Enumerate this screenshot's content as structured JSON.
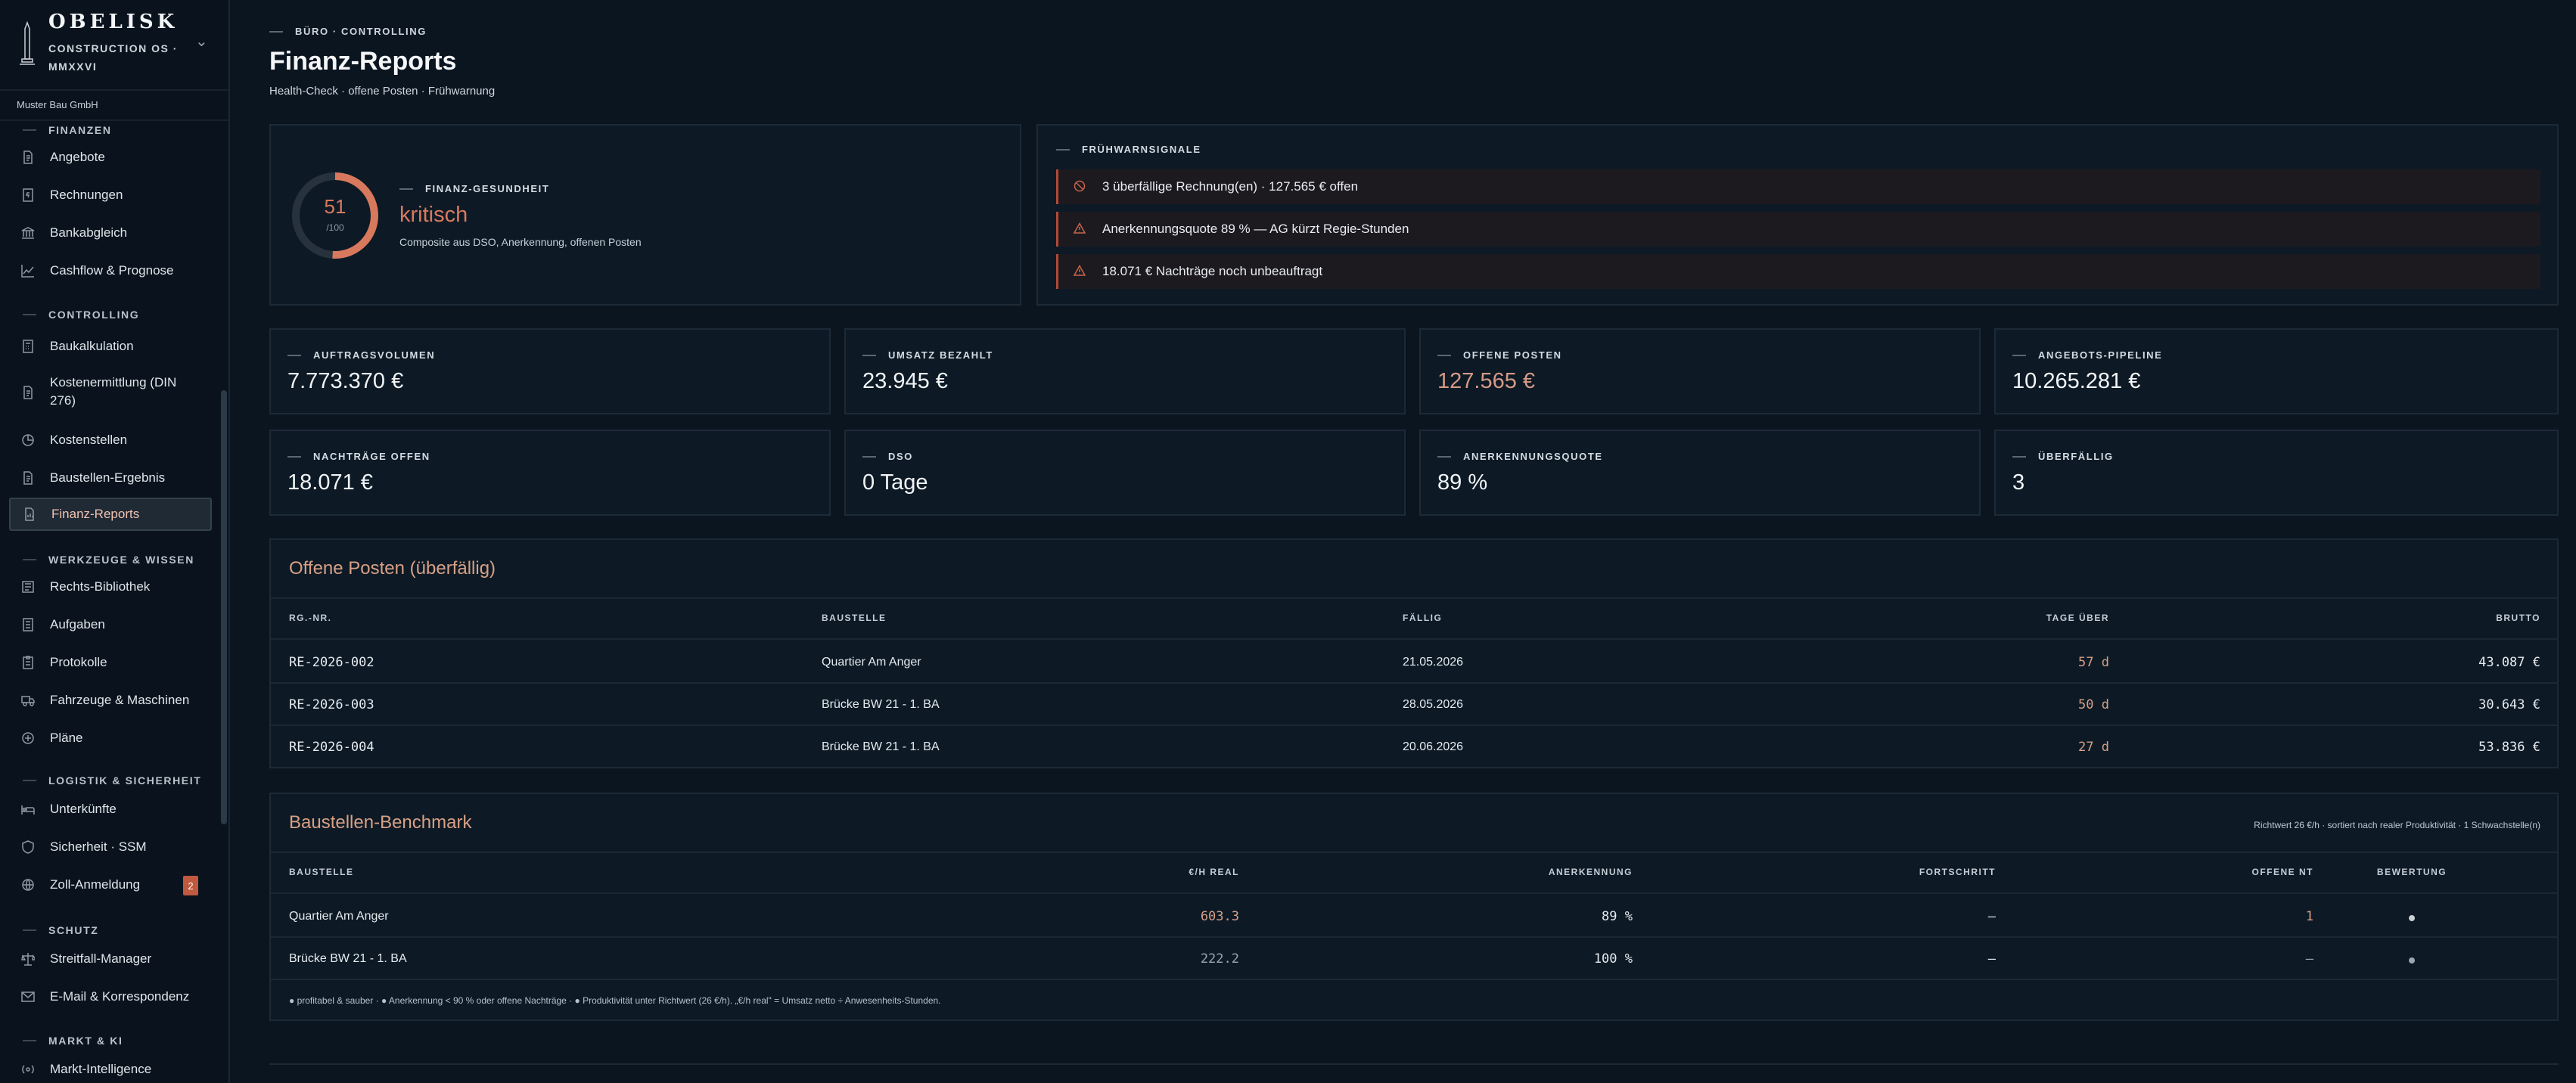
{
  "brand": {
    "name": "OBELISK",
    "subtitle": "CONSTRUCTION OS · MMXXVI",
    "company": "Muster Bau GmbH"
  },
  "sidebar": {
    "sections": [
      {
        "title": "FINANZEN",
        "items": [
          {
            "label": "Angebote",
            "icon": "document-icon"
          },
          {
            "label": "Rechnungen",
            "icon": "invoice-icon"
          },
          {
            "label": "Bankabgleich",
            "icon": "bank-icon"
          },
          {
            "label": "Cashflow & Prognose",
            "icon": "chart-line-icon"
          }
        ]
      },
      {
        "title": "CONTROLLING",
        "items": [
          {
            "label": "Baukalkulation",
            "icon": "calculator-icon"
          },
          {
            "label": "Kostenermittlung (DIN 276)",
            "icon": "document-icon"
          },
          {
            "label": "Kostenstellen",
            "icon": "pie-icon"
          },
          {
            "label": "Baustellen-Ergebnis",
            "icon": "document-icon"
          },
          {
            "label": "Finanz-Reports",
            "icon": "report-icon",
            "active": true
          }
        ]
      },
      {
        "title": "WERKZEUGE & WISSEN",
        "items": [
          {
            "label": "Rechts-Bibliothek",
            "icon": "library-icon"
          },
          {
            "label": "Aufgaben",
            "icon": "checklist-icon"
          },
          {
            "label": "Protokolle",
            "icon": "clipboard-icon"
          },
          {
            "label": "Fahrzeuge & Maschinen",
            "icon": "truck-icon"
          },
          {
            "label": "Pläne",
            "icon": "blueprint-icon"
          }
        ]
      },
      {
        "title": "LOGISTIK & SICHERHEIT",
        "items": [
          {
            "label": "Unterkünfte",
            "icon": "bed-icon"
          },
          {
            "label": "Sicherheit · SSM",
            "icon": "shield-icon"
          },
          {
            "label": "Zoll-Anmeldung",
            "icon": "globe-icon",
            "badge": "2"
          }
        ]
      },
      {
        "title": "SCHUTZ",
        "items": [
          {
            "label": "Streitfall-Manager",
            "icon": "scales-icon"
          },
          {
            "label": "E-Mail & Korrespondenz",
            "icon": "mail-icon"
          }
        ]
      },
      {
        "title": "MARKT & KI",
        "items": [
          {
            "label": "Markt-Intelligence",
            "icon": "radar-icon"
          }
        ]
      }
    ]
  },
  "page": {
    "breadcrumb": "BÜRO · CONTROLLING",
    "title": "Finanz-Reports",
    "subtitle": "Health-Check · offene Posten · Frühwarnung"
  },
  "health": {
    "label": "FINANZ-GESUNDHEIT",
    "score": "51",
    "score_value": 51,
    "max": "/100",
    "status": "kritisch",
    "description": "Composite aus DSO, Anerkennung, offenen Posten",
    "color": "#d8795d"
  },
  "warnings": {
    "label": "FRÜHWARNSIGNALE",
    "items": [
      {
        "icon": "clock-alert-icon",
        "text": "3 überfällige Rechnung(en) · 127.565 € offen"
      },
      {
        "icon": "warning-triangle-icon",
        "text": "Anerkennungsquote 89 % — AG kürzt Regie-Stunden"
      },
      {
        "icon": "warning-triangle-icon",
        "text": "18.071 € Nachträge noch unbeauftragt"
      }
    ]
  },
  "kpis": [
    {
      "label": "AUFTRAGSVOLUMEN",
      "value": "7.773.370 €"
    },
    {
      "label": "UMSATZ BEZAHLT",
      "value": "23.945 €"
    },
    {
      "label": "OFFENE POSTEN",
      "value": "127.565 €",
      "warm": true
    },
    {
      "label": "ANGEBOTS-PIPELINE",
      "value": "10.265.281 €"
    },
    {
      "label": "NACHTRÄGE OFFEN",
      "value": "18.071 €"
    },
    {
      "label": "DSO",
      "value": "0 Tage"
    },
    {
      "label": "ANERKENNUNGSQUOTE",
      "value": "89 %"
    },
    {
      "label": "ÜBERFÄLLIG",
      "value": "3"
    }
  ],
  "open_items": {
    "title": "Offene Posten (überfällig)",
    "columns": [
      "RG.-NR.",
      "BAUSTELLE",
      "FÄLLIG",
      "TAGE ÜBER",
      "BRUTTO"
    ],
    "rows": [
      [
        "RE-2026-002",
        "Quartier Am Anger",
        "21.05.2026",
        "57 d",
        "43.087 €"
      ],
      [
        "RE-2026-003",
        "Brücke BW 21 - 1. BA",
        "28.05.2026",
        "50 d",
        "30.643 €"
      ],
      [
        "RE-2026-004",
        "Brücke BW 21 - 1. BA",
        "20.06.2026",
        "27 d",
        "53.836 €"
      ]
    ]
  },
  "benchmark": {
    "title": "Baustellen-Benchmark",
    "note": "Richtwert 26 €/h · sortiert nach realer Produktivität · 1 Schwachstelle(n)",
    "columns": [
      "BAUSTELLE",
      "€/H REAL",
      "ANERKENNUNG",
      "FORTSCHRITT",
      "OFFENE NT",
      "BEWERTUNG"
    ],
    "rows": [
      [
        "Quartier Am Anger",
        "603.3",
        "89 %",
        "—",
        "1",
        "●"
      ],
      [
        "Brücke BW 21 - 1. BA",
        "222.2",
        "100 %",
        "—",
        "—",
        "●"
      ]
    ],
    "footnote": "● profitabel & sauber · ● Anerkennung < 90 % oder offene Nachträge · ● Produktivität unter Richtwert (26 €/h). „€/h real\" = Umsatz netto ÷ Anwesenheits-Stunden."
  }
}
